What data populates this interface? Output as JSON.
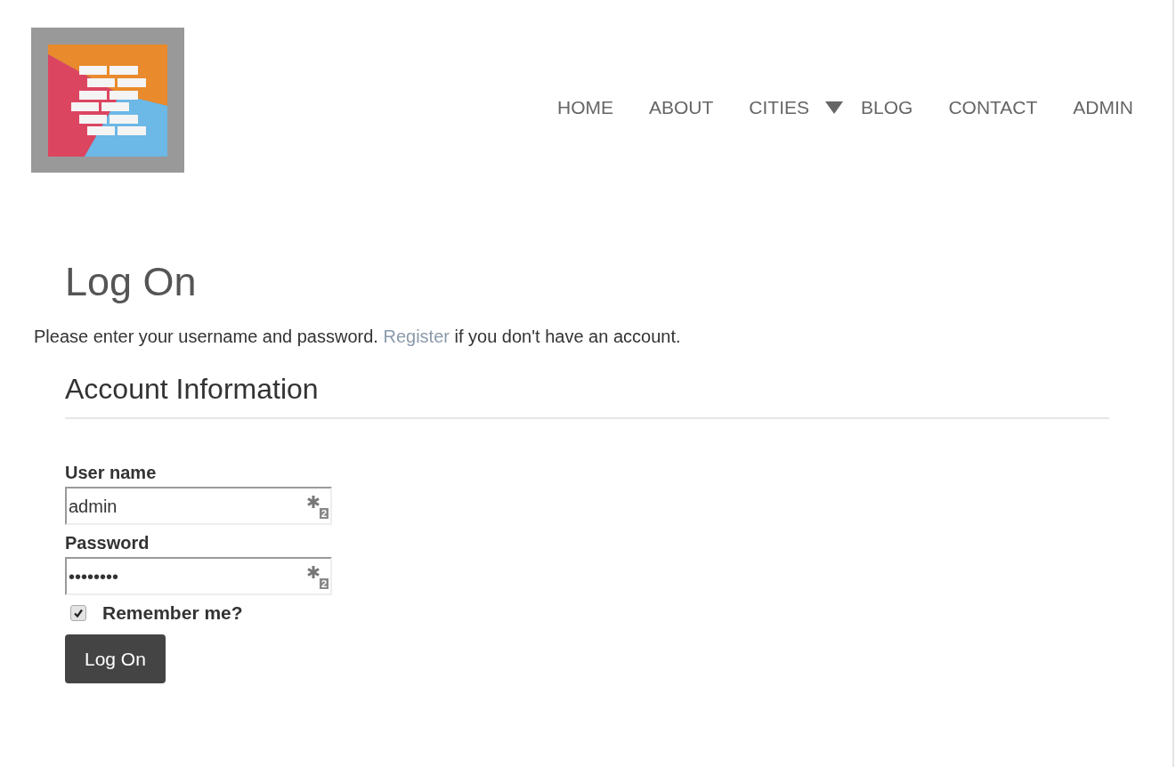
{
  "nav": [
    {
      "label": "HOME",
      "has_dropdown": false
    },
    {
      "label": "ABOUT",
      "has_dropdown": false
    },
    {
      "label": "CITIES",
      "has_dropdown": true
    },
    {
      "label": "BLOG",
      "has_dropdown": false
    },
    {
      "label": "CONTACT",
      "has_dropdown": false
    },
    {
      "label": "ADMIN",
      "has_dropdown": false
    }
  ],
  "title": "Log On",
  "intro": {
    "before": "Please enter your username and password. ",
    "link": "Register",
    "after": " if you don't have an account."
  },
  "section_title": "Account Information",
  "fields": [
    {
      "label": "User name",
      "value": "admin",
      "badge": "2"
    },
    {
      "label": "Password",
      "value": "••••••••",
      "badge": "2"
    }
  ],
  "remember": {
    "label": "Remember me?",
    "checked": true
  },
  "submit": "Log On"
}
